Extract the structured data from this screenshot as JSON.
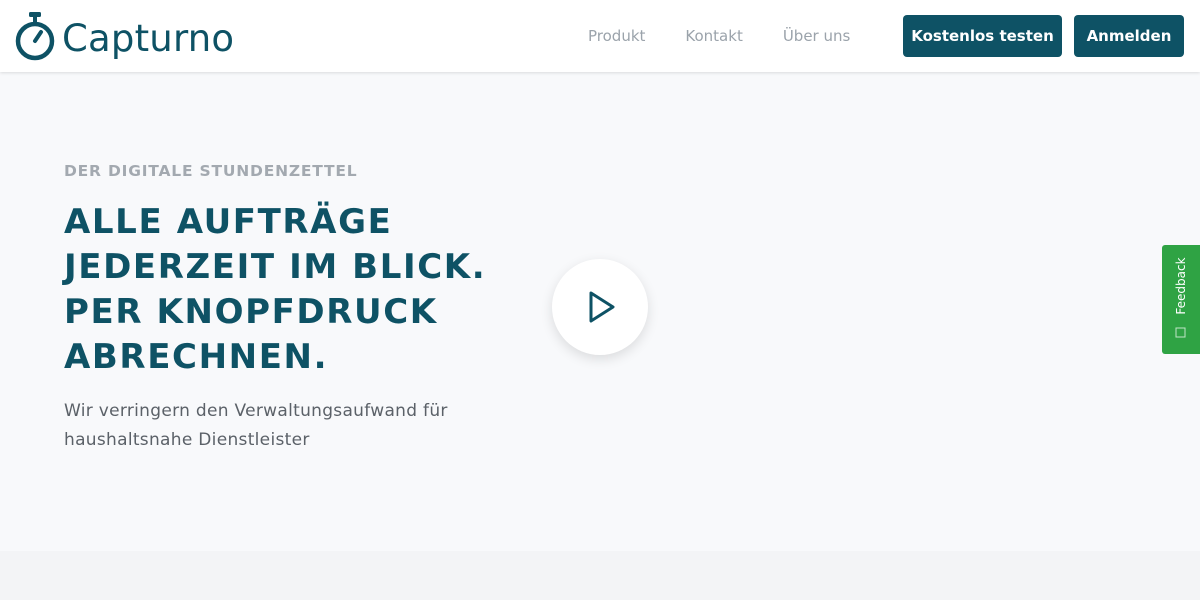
{
  "brand": {
    "name": "Capturno",
    "primary_color": "#0e5265",
    "logo_icon": "stopwatch-icon"
  },
  "nav": {
    "items": [
      {
        "label": "Produkt"
      },
      {
        "label": "Kontakt"
      },
      {
        "label": "Über uns"
      }
    ]
  },
  "actions": {
    "trial_label": "Kostenlos testen",
    "login_label": "Anmelden"
  },
  "hero": {
    "eyebrow": "DER DIGITALE STUNDENZETTEL",
    "headline_lines": [
      "ALLE AUFTRÄGE",
      "JEDERZEIT IM BLICK.",
      "PER KNOPFDRUCK",
      "ABRECHNEN."
    ],
    "subtext": "Wir verringern den Verwaltungsaufwand für haushaltsnahe Dienstleister",
    "play_icon": "play-icon"
  },
  "feedback": {
    "label": "Feedback",
    "color": "#2fa344",
    "icon": "feedback-icon"
  }
}
